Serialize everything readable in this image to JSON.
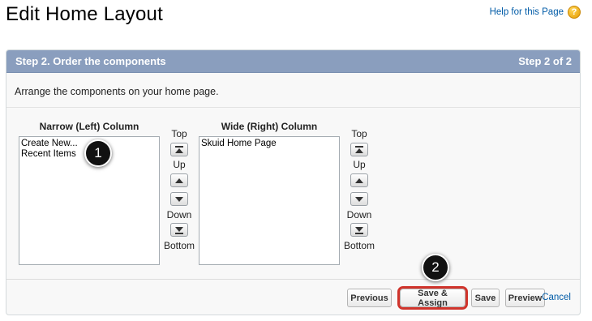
{
  "page": {
    "title": "Edit Home Layout",
    "help_link": "Help for this Page"
  },
  "panel": {
    "step_title": "Step 2. Order the components",
    "step_counter": "Step 2 of 2",
    "instructions": "Arrange the components on your home page."
  },
  "narrow_column": {
    "label": "Narrow (Left) Column",
    "items": [
      "Create New...",
      "Recent Items"
    ]
  },
  "wide_column": {
    "label": "Wide (Right) Column",
    "items": [
      "Skuid Home Page"
    ]
  },
  "controls": {
    "top": "Top",
    "up": "Up",
    "down": "Down",
    "bottom": "Bottom"
  },
  "footer": {
    "previous": "Previous",
    "save_assign": "Save & Assign",
    "save": "Save",
    "preview": "Preview",
    "cancel": "Cancel"
  },
  "annotations": {
    "marker_1": "1",
    "marker_2": "2"
  }
}
